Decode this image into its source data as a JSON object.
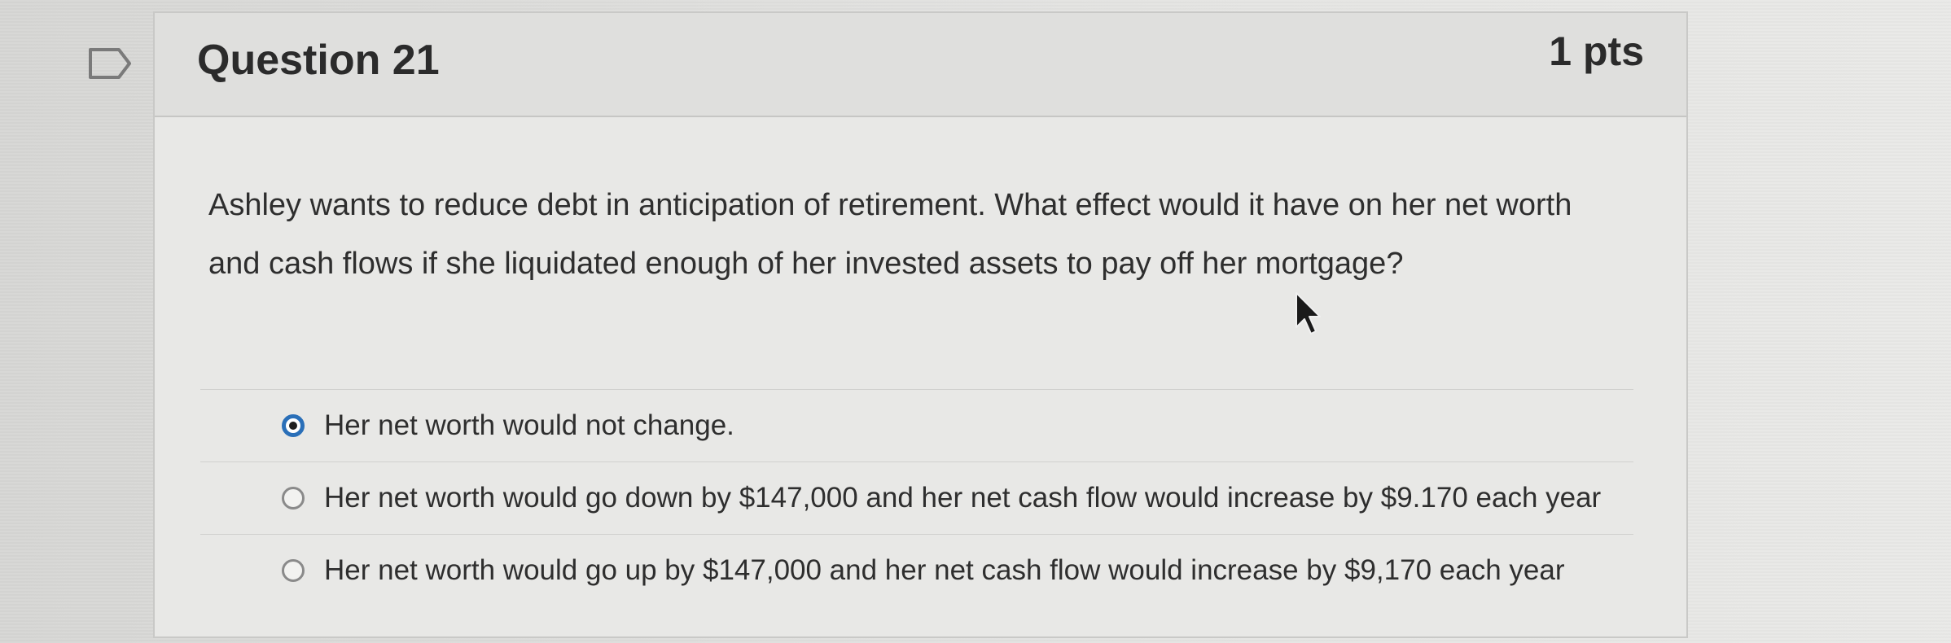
{
  "question": {
    "title": "Question 21",
    "points": "1 pts",
    "text": "Ashley wants to reduce debt in anticipation of retirement. What effect would it have on her net worth and cash flows if she liquidated enough of her invested assets to pay off her mortgage?",
    "flag_icon": "flag-outline-icon"
  },
  "answers": [
    {
      "label": "Her net worth would not change.",
      "selected": true
    },
    {
      "label": "Her net worth would go down by $147,000 and her net cash flow would increase by $9.170 each year",
      "selected": false
    },
    {
      "label": "Her net worth would go up by $147,000 and her net cash flow would increase by $9,170 each year",
      "selected": false
    }
  ],
  "colors": {
    "radio_selected": "#2a6fb8",
    "text": "#2e2e2e"
  }
}
